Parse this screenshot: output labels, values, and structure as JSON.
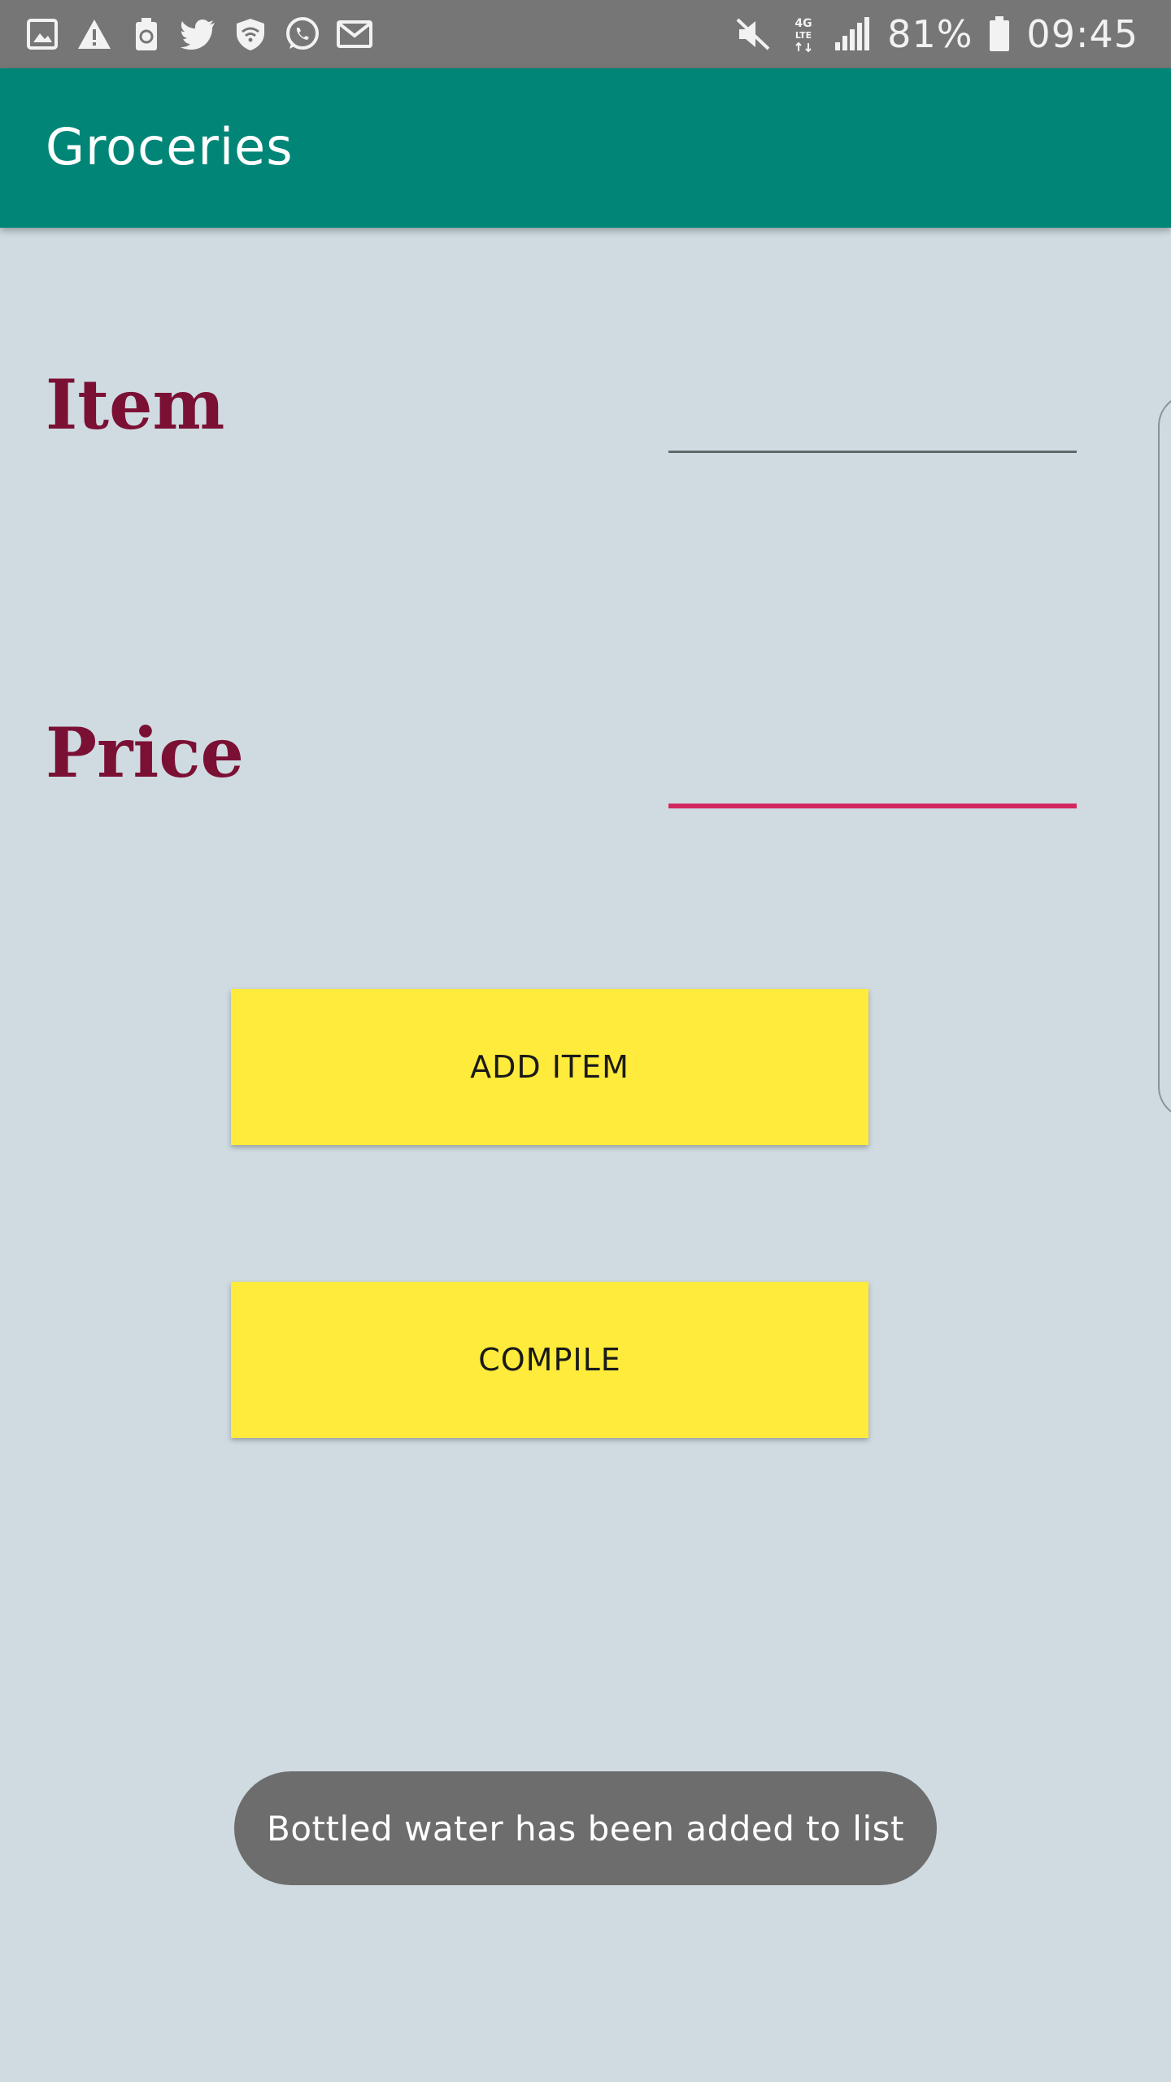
{
  "status_bar": {
    "left_icons": [
      "gallery-icon",
      "warning-icon",
      "battery-recycle-icon",
      "twitter-icon",
      "wifi-shield-icon",
      "whatsapp-icon",
      "mail-icon"
    ],
    "right_icons": [
      "mute-icon",
      "lte-4g-icon",
      "signal-icon",
      "battery-icon"
    ],
    "battery_percent": "81%",
    "time": "09:45"
  },
  "app_bar": {
    "title": "Groceries"
  },
  "form": {
    "item_label": "Item",
    "item_value": "",
    "price_label": "Price",
    "price_value": ""
  },
  "buttons": {
    "add_item": "ADD ITEM",
    "compile": "COMPILE"
  },
  "toast": {
    "message": "Bottled water has been added to list"
  },
  "colors": {
    "status_bar": "#767676",
    "app_bar": "#018577",
    "background": "#cfdbe0",
    "label": "#7b1035",
    "active_underline": "#d3285f",
    "button": "#ffeb3b",
    "toast": "#6d6d6d"
  }
}
